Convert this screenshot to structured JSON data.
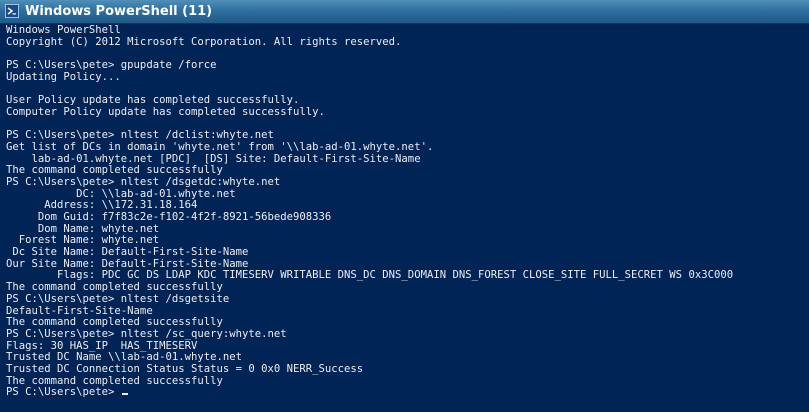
{
  "window": {
    "title": "Windows PowerShell (11)"
  },
  "console": {
    "lines": [
      "Windows PowerShell",
      "Copyright (C) 2012 Microsoft Corporation. All rights reserved.",
      "",
      "PS C:\\Users\\pete> gpupdate /force",
      "Updating Policy...",
      "",
      "User Policy update has completed successfully.",
      "Computer Policy update has completed successfully.",
      "",
      "PS C:\\Users\\pete> nltest /dclist:whyte.net",
      "Get list of DCs in domain 'whyte.net' from '\\\\lab-ad-01.whyte.net'.",
      "    lab-ad-01.whyte.net [PDC]  [DS] Site: Default-First-Site-Name",
      "The command completed successfully",
      "PS C:\\Users\\pete> nltest /dsgetdc:whyte.net",
      "           DC: \\\\lab-ad-01.whyte.net",
      "      Address: \\\\172.31.18.164",
      "     Dom Guid: f7f83c2e-f102-4f2f-8921-56bede908336",
      "     Dom Name: whyte.net",
      "  Forest Name: whyte.net",
      " Dc Site Name: Default-First-Site-Name",
      "Our Site Name: Default-First-Site-Name",
      "        Flags: PDC GC DS LDAP KDC TIMESERV WRITABLE DNS_DC DNS_DOMAIN DNS_FOREST CLOSE_SITE FULL_SECRET WS 0x3C000",
      "The command completed successfully",
      "PS C:\\Users\\pete> nltest /dsgetsite",
      "Default-First-Site-Name",
      "The command completed successfully",
      "PS C:\\Users\\pete> nltest /sc_query:whyte.net",
      "Flags: 30 HAS_IP  HAS_TIMESERV",
      "Trusted DC Name \\\\lab-ad-01.whyte.net",
      "Trusted DC Connection Status Status = 0 0x0 NERR_Success",
      "The command completed successfully"
    ],
    "prompt": "PS C:\\Users\\pete> "
  },
  "colors": {
    "background": "#012456",
    "text": "#eeedf0",
    "titlebar": "#2f6f9f"
  },
  "icons": {
    "app": "powershell-icon"
  }
}
